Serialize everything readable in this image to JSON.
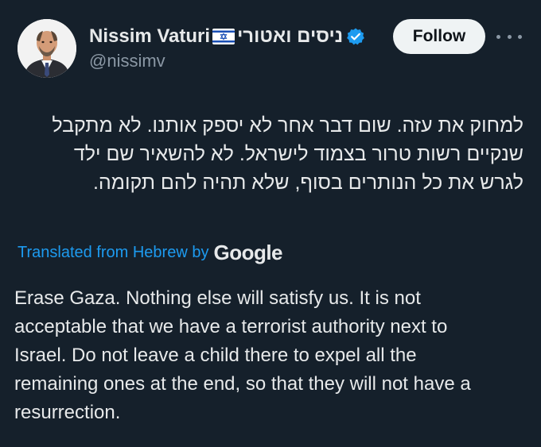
{
  "author": {
    "display_name": "Nissim Vaturi",
    "hebrew_name": "ניסים ואטורי",
    "handle": "@nissimv",
    "flag_icon": "israel-flag-icon",
    "verified_icon": "verified-badge-icon",
    "verified_color": "#1d9bf0"
  },
  "actions": {
    "follow_label": "Follow",
    "more_icon": "more-horizontal-icon"
  },
  "tweet": {
    "hebrew_lines": [
      "למחוק את עזה. שום דבר אחר לא יספק אותנו. לא מתקבל",
      "שנקיים רשות טרור בצמוד לישראל. לא להשאיר שם ילד",
      "לגרש את כל הנותרים בסוף, שלא תהיה להם תקומה."
    ],
    "translated_from": "Translated from Hebrew by",
    "translator": "Google",
    "english_lines": [
      "Erase Gaza. Nothing else will satisfy us. It is not",
      "acceptable that we have a terrorist authority next to",
      "Israel. Do not leave a child there to expel all the",
      "remaining ones at the end, so that they will not have a",
      "resurrection."
    ]
  },
  "colors": {
    "background": "#15202b",
    "text": "#e7e9ea",
    "secondary_text": "#8b98a5",
    "link": "#1d9bf0",
    "follow_button_bg": "#eff3f4"
  }
}
